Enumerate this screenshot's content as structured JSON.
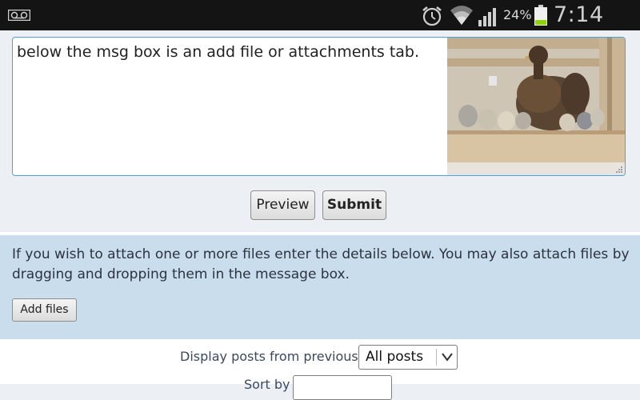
{
  "status_bar": {
    "battery_percent": "24%",
    "time": "7:14 PM",
    "icons": [
      "voicemail-icon",
      "alarm-icon",
      "wifi-icon",
      "signal-icon",
      "battery-icon"
    ]
  },
  "message_box": {
    "text": "below the msg box is an add file or attachments tab."
  },
  "buttons": {
    "preview": "Preview",
    "submit": "Submit",
    "add_files": "Add files"
  },
  "attachments": {
    "instructions": "If you wish to attach one or more files enter the details below. You may also attach files by dragging and dropping them in the message box."
  },
  "display_options": {
    "display_label": "Display posts from previous:",
    "display_value": "All posts",
    "sort_label": "Sort by"
  },
  "colors": {
    "textarea_border": "#4aa3df",
    "attach_panel_bg": "#cadded"
  }
}
